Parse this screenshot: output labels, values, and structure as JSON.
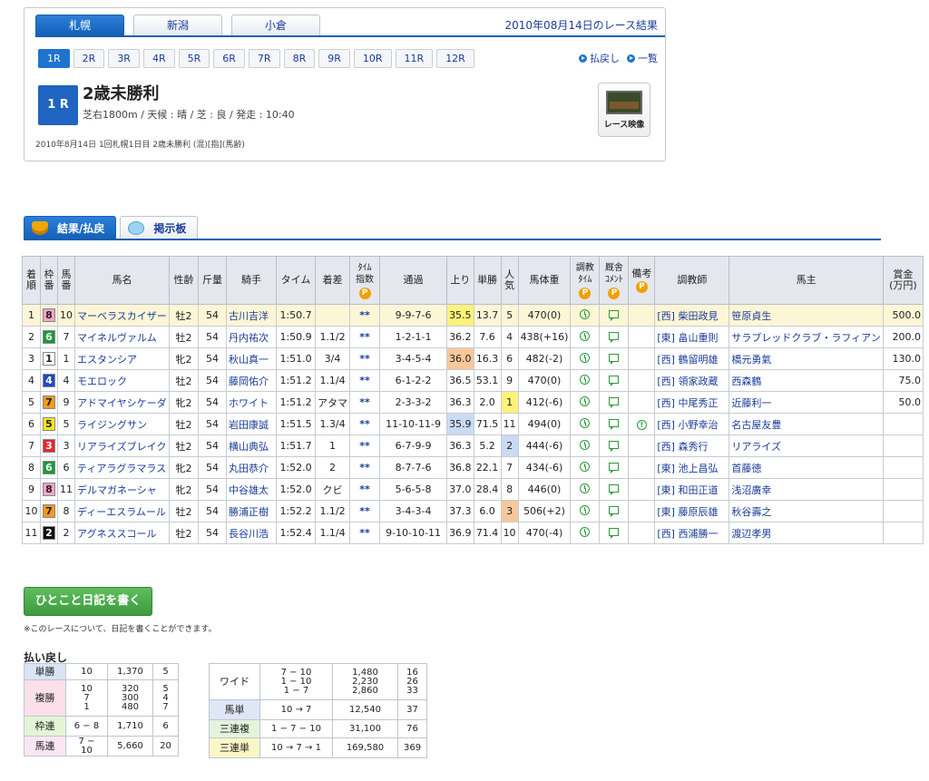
{
  "header": {
    "venues": [
      "札幌",
      "新潟",
      "小倉"
    ],
    "date_title": "2010年08月14日のレース結果",
    "race_numbers": [
      "1R",
      "2R",
      "3R",
      "4R",
      "5R",
      "6R",
      "7R",
      "8R",
      "9R",
      "10R",
      "11R",
      "12R"
    ],
    "links": {
      "payout": "払戻し",
      "list": "一覧"
    },
    "race_badge": "1 R",
    "race_name": "2歳未勝利",
    "conditions": "芝右1800m / 天候 : 晴 / 芝 : 良 / 発走 : 10:40",
    "meta": "2010年8月14日 1回札幌1日目 2歳未勝利 (混)[指](馬齢)",
    "video_label": "レース映像"
  },
  "tabs": {
    "result": "結果/払戻",
    "board": "掲示板"
  },
  "table": {
    "headers": {
      "rank": "着\n順",
      "waku": "枠\n番",
      "umaban": "馬\n番",
      "name": "馬名",
      "sexage": "性齢",
      "weight": "斤量",
      "jockey": "騎手",
      "time": "タイム",
      "margin": "着差",
      "time_index": "ﾀｲﾑ\n指数",
      "passing": "通過",
      "last3f": "上り",
      "odds": "単勝",
      "pop": "人\n気",
      "body": "馬体重",
      "train_time": "調教\nﾀｲﾑ",
      "stable_cmt": "厩舎\nｺﾒﾝﾄ",
      "notes": "備考",
      "trainer": "調教師",
      "owner": "馬主",
      "prize": "賞金\n(万円)",
      "premium_mark": "P"
    },
    "rows": [
      {
        "rank": "1",
        "waku": "8",
        "num": "10",
        "name": "マーベラスカイザー",
        "sexage": "牡2",
        "kg": "54",
        "jockey": "古川吉洋",
        "time": "1:50.7",
        "margin": "",
        "idx": "**",
        "pass": "9-9-7-6",
        "last": "35.5",
        "odds": "13.7",
        "pop": "5",
        "body": "470(0)",
        "note": "",
        "trainer": "[西] 柴田政見",
        "owner": "笹原貞生",
        "prize": "500.0"
      },
      {
        "rank": "2",
        "waku": "6",
        "num": "7",
        "name": "マイネルヴァルム",
        "sexage": "牡2",
        "kg": "54",
        "jockey": "丹内祐次",
        "time": "1:50.9",
        "margin": "1.1/2",
        "idx": "**",
        "pass": "1-2-1-1",
        "last": "36.2",
        "odds": "7.6",
        "pop": "4",
        "body": "438(+16)",
        "note": "",
        "trainer": "[東] 畠山重則",
        "owner": "サラブレッドクラブ・ラフィアン",
        "prize": "200.0"
      },
      {
        "rank": "3",
        "waku": "1",
        "num": "1",
        "name": "エスタンシア",
        "sexage": "牝2",
        "kg": "54",
        "jockey": "秋山真一",
        "time": "1:51.0",
        "margin": "3/4",
        "idx": "**",
        "pass": "3-4-5-4",
        "last": "36.0",
        "odds": "16.3",
        "pop": "6",
        "body": "482(-2)",
        "note": "",
        "trainer": "[西] 鶴留明雄",
        "owner": "橋元勇氣",
        "prize": "130.0"
      },
      {
        "rank": "4",
        "waku": "4",
        "num": "4",
        "name": "モエロック",
        "sexage": "牡2",
        "kg": "54",
        "jockey": "藤岡佑介",
        "time": "1:51.2",
        "margin": "1.1/4",
        "idx": "**",
        "pass": "6-1-2-2",
        "last": "36.5",
        "odds": "53.1",
        "pop": "9",
        "body": "470(0)",
        "note": "",
        "trainer": "[西] 領家政蔵",
        "owner": "西森鶴",
        "prize": "75.0"
      },
      {
        "rank": "5",
        "waku": "7",
        "num": "9",
        "name": "アドマイヤシケーダ",
        "sexage": "牝2",
        "kg": "54",
        "jockey": "ホワイト",
        "time": "1:51.2",
        "margin": "アタマ",
        "idx": "**",
        "pass": "2-3-3-2",
        "last": "36.3",
        "odds": "2.0",
        "pop": "1",
        "body": "412(-6)",
        "note": "",
        "trainer": "[西] 中尾秀正",
        "owner": "近藤利一",
        "prize": "50.0"
      },
      {
        "rank": "6",
        "waku": "5",
        "num": "5",
        "name": "ライジングサン",
        "sexage": "牡2",
        "kg": "54",
        "jockey": "岩田康誠",
        "time": "1:51.5",
        "margin": "1.3/4",
        "idx": "**",
        "pass": "11-10-11-9",
        "last": "35.9",
        "odds": "71.5",
        "pop": "11",
        "body": "494(0)",
        "note": "!",
        "trainer": "[西] 小野幸治",
        "owner": "名古屋友豊",
        "prize": ""
      },
      {
        "rank": "7",
        "waku": "3",
        "num": "3",
        "name": "リアライズブレイク",
        "sexage": "牡2",
        "kg": "54",
        "jockey": "横山典弘",
        "time": "1:51.7",
        "margin": "1",
        "idx": "**",
        "pass": "6-7-9-9",
        "last": "36.3",
        "odds": "5.2",
        "pop": "2",
        "body": "444(-6)",
        "note": "",
        "trainer": "[西] 森秀行",
        "owner": "リアライズ",
        "prize": ""
      },
      {
        "rank": "8",
        "waku": "6",
        "num": "6",
        "name": "ティアラグラマラス",
        "sexage": "牝2",
        "kg": "54",
        "jockey": "丸田恭介",
        "time": "1:52.0",
        "margin": "2",
        "idx": "**",
        "pass": "8-7-7-6",
        "last": "36.8",
        "odds": "22.1",
        "pop": "7",
        "body": "434(-6)",
        "note": "",
        "trainer": "[東] 池上昌弘",
        "owner": "首藤徳",
        "prize": ""
      },
      {
        "rank": "9",
        "waku": "8",
        "num": "11",
        "name": "デルマガネーシャ",
        "sexage": "牝2",
        "kg": "54",
        "jockey": "中谷雄太",
        "time": "1:52.0",
        "margin": "クビ",
        "idx": "**",
        "pass": "5-6-5-8",
        "last": "37.0",
        "odds": "28.4",
        "pop": "8",
        "body": "446(0)",
        "note": "",
        "trainer": "[東] 和田正道",
        "owner": "浅沼廣幸",
        "prize": ""
      },
      {
        "rank": "10",
        "waku": "7",
        "num": "8",
        "name": "ディーエスラムール",
        "sexage": "牡2",
        "kg": "54",
        "jockey": "勝浦正樹",
        "time": "1:52.2",
        "margin": "1.1/2",
        "idx": "**",
        "pass": "3-4-3-4",
        "last": "37.3",
        "odds": "6.0",
        "pop": "3",
        "body": "506(+2)",
        "note": "",
        "trainer": "[東] 藤原辰雄",
        "owner": "秋谷壽之",
        "prize": ""
      },
      {
        "rank": "11",
        "waku": "2",
        "num": "2",
        "name": "アグネススコール",
        "sexage": "牡2",
        "kg": "54",
        "jockey": "長谷川浩",
        "time": "1:52.4",
        "margin": "1.1/4",
        "idx": "**",
        "pass": "9-10-10-11",
        "last": "36.9",
        "odds": "71.4",
        "pop": "10",
        "body": "470(-4)",
        "note": "",
        "trainer": "[西] 西浦勝一",
        "owner": "渡辺孝男",
        "prize": ""
      }
    ]
  },
  "diary": {
    "button": "ひとこと日記を書く",
    "note": "※このレースについて、日記を書くことができます。"
  },
  "payout": {
    "title": "払い戻し",
    "left": [
      {
        "kind": "単勝",
        "combo": "10",
        "amount": "1,370",
        "pop": "5"
      },
      {
        "kind": "複勝",
        "combo": "10\n7\n1",
        "amount": "320\n300\n480",
        "pop": "5\n4\n7"
      },
      {
        "kind": "枠連",
        "combo": "6 − 8",
        "amount": "1,710",
        "pop": "6"
      },
      {
        "kind": "馬連",
        "combo": "7 − 10",
        "amount": "5,660",
        "pop": "20"
      }
    ],
    "right": [
      {
        "kind": "ワイド",
        "combo": "7 − 10\n1 − 10\n1 − 7",
        "amount": "1,480\n2,230\n2,860",
        "pop": "16\n26\n33"
      },
      {
        "kind": "馬単",
        "combo": "10 → 7",
        "amount": "12,540",
        "pop": "37"
      },
      {
        "kind": "三連複",
        "combo": "1 − 7 − 10",
        "amount": "31,100",
        "pop": "76"
      },
      {
        "kind": "三連単",
        "combo": "10 → 7 → 1",
        "amount": "169,580",
        "pop": "369"
      }
    ]
  },
  "colors": {
    "accent": "#1460b8",
    "waku": {
      "1": "#ffffff",
      "2": "#111111",
      "3": "#e8262b",
      "4": "#1e46c8",
      "5": "#f7e51e",
      "6": "#1a9a3a",
      "7": "#f39a1e",
      "8": "#f6a4c6"
    }
  }
}
